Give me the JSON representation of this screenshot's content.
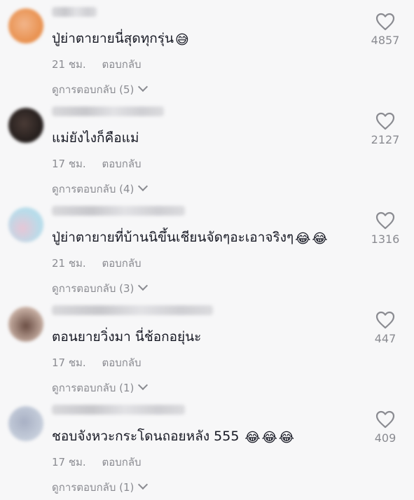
{
  "comments": [
    {
      "text": "ปู่ย่าตายายนี่สุดทุกรุ่น",
      "emojis": [
        "😅"
      ],
      "time": "21 ชม.",
      "reply_label": "ตอบกลับ",
      "view_replies": "ดูการตอบกลับ (5)",
      "likes": "4857",
      "avatar_colors": [
        "#f2b58a",
        "#e88f4c"
      ]
    },
    {
      "text": "แม่ยังไงก็คือแม่",
      "emojis": [],
      "time": "17 ชม.",
      "reply_label": "ตอบกลับ",
      "view_replies": "ดูการตอบกลับ (4)",
      "likes": "2127",
      "avatar_colors": [
        "#4a3b36",
        "#1f1a19"
      ]
    },
    {
      "text": "ปู่ย่าตายายที่บ้านนิขึ้นเชียนจัดๆอะเอาจริงๆ",
      "emojis": [
        "😂",
        "😂"
      ],
      "time": "21 ชม.",
      "reply_label": "ตอบกลับ",
      "view_replies": "ดูการตอบกลับ (3)",
      "likes": "1316",
      "avatar_colors": [
        "#b8dcea",
        "#e7c6d6"
      ]
    },
    {
      "text": "ตอนยายวิ่งมา นี่ช้อกอยุ่นะ",
      "emojis": [],
      "time": "17 ชม.",
      "reply_label": "ตอบกลับ",
      "view_replies": "ดูการตอบกลับ (1)",
      "likes": "447",
      "avatar_colors": [
        "#c9b1a5",
        "#6b4e44"
      ]
    },
    {
      "text": "ชอบจังหวะกระโดนถอยหลัง 555",
      "emojis": [
        "😂",
        "😂",
        "😂"
      ],
      "time": "17 ชม.",
      "reply_label": "ตอบกลับ",
      "view_replies": "ดูการตอบกลับ (1)",
      "likes": "409",
      "avatar_colors": [
        "#c7cfdc",
        "#a8b0c4"
      ]
    }
  ],
  "icons": {
    "like": "heart-outline-icon",
    "expand": "chevron-down-icon"
  }
}
